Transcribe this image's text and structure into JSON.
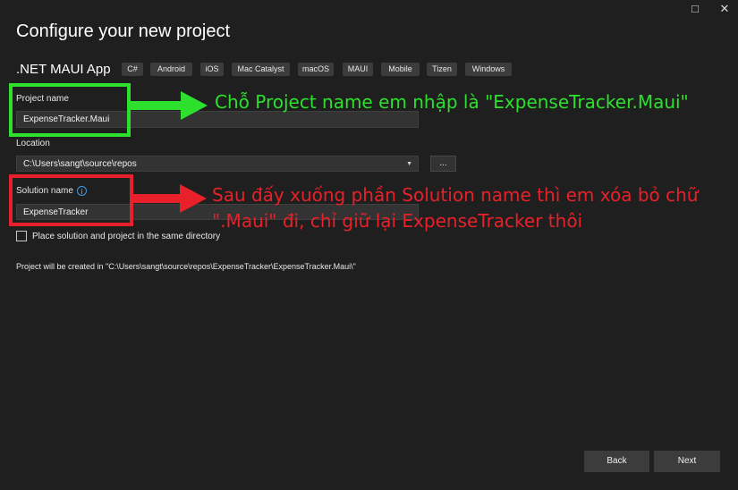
{
  "window": {
    "maximize_icon": "□",
    "close_icon": "✕"
  },
  "header": {
    "title": "Configure your new project",
    "template_name": ".NET MAUI App",
    "tags": [
      "C#",
      "Android",
      "iOS",
      "Mac Catalyst",
      "macOS",
      "MAUI",
      "Mobile",
      "Tizen",
      "Windows"
    ]
  },
  "form": {
    "project_name": {
      "label": "Project name",
      "value": "ExpenseTracker.Maui"
    },
    "location": {
      "label": "Location",
      "value": "C:\\Users\\sangt\\source\\repos",
      "browse_label": "..."
    },
    "solution_name": {
      "label": "Solution name",
      "value": "ExpenseTracker",
      "info_icon": "i"
    },
    "same_directory": {
      "label": "Place solution and project in the same directory",
      "checked": false
    },
    "summary": "Project will be created in \"C:\\Users\\sangt\\source\\repos\\ExpenseTracker\\ExpenseTracker.Maui\\\""
  },
  "annotations": {
    "green_text": "Chỗ Project name em nhập là \"ExpenseTracker.Maui\"",
    "red_text_line1": "Sau đấy xuống phần Solution name thì em xóa bỏ chữ",
    "red_text_line2": "\".Maui\" đi, chỉ giữ lại ExpenseTracker thôi",
    "green_color": "#2ee02e",
    "red_color": "#e8202a"
  },
  "footer": {
    "back_label": "Back",
    "next_label": "Next"
  }
}
